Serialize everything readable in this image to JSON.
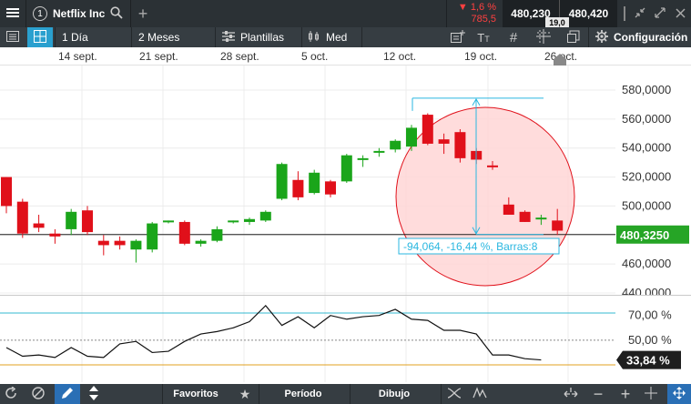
{
  "header": {
    "menu_icon": "hamburger-menu-icon",
    "tab_number": "1",
    "instrument_name": "Netflix Inc",
    "change_percent": "1,6 %",
    "change_points": "785,5",
    "bid_price": "480,230",
    "spread": "19,0",
    "ask_price": "480,420"
  },
  "toolbar": {
    "interval": "1 Día",
    "range": "2 Meses",
    "templates": "Plantillas",
    "chart_type": "Med",
    "settings": "Configuración"
  },
  "date_axis": [
    "14 sept.",
    "21 sept.",
    "28 sept.",
    "5 oct.",
    "12 oct.",
    "19 oct.",
    "26 oct."
  ],
  "chart_data": {
    "type": "candlestick",
    "instrument": "Netflix Inc",
    "y_ticks": [
      "580,0000",
      "560,0000",
      "540,0000",
      "520,0000",
      "500,0000",
      "480,0000",
      "460,0000",
      "440,0000"
    ],
    "ylim": [
      440,
      590
    ],
    "current_price_label": "480,3250",
    "current_price": 480.325,
    "up_color": "#1aa51a",
    "down_color": "#e0101a",
    "candles": [
      {
        "o": 520,
        "h": 520,
        "l": 495,
        "c": 500
      },
      {
        "o": 503,
        "h": 505,
        "l": 478,
        "c": 481
      },
      {
        "o": 488,
        "h": 494,
        "l": 482,
        "c": 485
      },
      {
        "o": 481,
        "h": 484,
        "l": 474,
        "c": 479
      },
      {
        "o": 484,
        "h": 498,
        "l": 480,
        "c": 496
      },
      {
        "o": 497,
        "h": 500,
        "l": 480,
        "c": 482
      },
      {
        "o": 476,
        "h": 480,
        "l": 466,
        "c": 473
      },
      {
        "o": 476,
        "h": 479,
        "l": 470,
        "c": 473
      },
      {
        "o": 470,
        "h": 477,
        "l": 461,
        "c": 476
      },
      {
        "o": 470,
        "h": 489,
        "l": 468,
        "c": 488
      },
      {
        "o": 489,
        "h": 490,
        "l": 488,
        "c": 490
      },
      {
        "o": 489,
        "h": 490,
        "l": 473,
        "c": 474
      },
      {
        "o": 474,
        "h": 477,
        "l": 472,
        "c": 476
      },
      {
        "o": 476,
        "h": 486,
        "l": 475,
        "c": 484
      },
      {
        "o": 489,
        "h": 490,
        "l": 488,
        "c": 490
      },
      {
        "o": 489,
        "h": 492,
        "l": 487,
        "c": 491
      },
      {
        "o": 490,
        "h": 497,
        "l": 489,
        "c": 496
      },
      {
        "o": 505,
        "h": 530,
        "l": 504,
        "c": 529
      },
      {
        "o": 518,
        "h": 524,
        "l": 504,
        "c": 506
      },
      {
        "o": 509,
        "h": 525,
        "l": 508,
        "c": 523
      },
      {
        "o": 517,
        "h": 518,
        "l": 506,
        "c": 508
      },
      {
        "o": 517,
        "h": 536,
        "l": 516,
        "c": 535
      },
      {
        "o": 533,
        "h": 535,
        "l": 527,
        "c": 533
      },
      {
        "o": 537,
        "h": 540,
        "l": 534,
        "c": 538
      },
      {
        "o": 539,
        "h": 546,
        "l": 537,
        "c": 545
      },
      {
        "o": 541,
        "h": 556,
        "l": 538,
        "c": 554
      },
      {
        "o": 563,
        "h": 564,
        "l": 542,
        "c": 543
      },
      {
        "o": 546,
        "h": 550,
        "l": 536,
        "c": 543
      },
      {
        "o": 551,
        "h": 553,
        "l": 530,
        "c": 533
      },
      {
        "o": 538,
        "h": 540,
        "l": 529,
        "c": 532
      },
      {
        "o": 528,
        "h": 531,
        "l": 525,
        "c": 527
      },
      {
        "o": 501,
        "h": 506,
        "l": 494,
        "c": 494
      },
      {
        "o": 496,
        "h": 497,
        "l": 489,
        "c": 489
      },
      {
        "o": 491,
        "h": 494,
        "l": 487,
        "c": 492
      },
      {
        "o": 490,
        "h": 498,
        "l": 480,
        "c": 483
      }
    ],
    "measurement_label": "-94,064, -16,44 %, Barras:8",
    "measure_from": 574.4,
    "measure_to": 480.3,
    "oscillator": {
      "y_ticks": [
        "70,00 %",
        "50,00 %"
      ],
      "ylim": [
        20,
        80
      ],
      "upper_level": 72,
      "middle_level": 50,
      "lower_level": 30,
      "current_label": "33,84 %",
      "values": [
        44,
        37,
        38,
        36,
        44,
        37,
        36,
        47,
        49,
        40,
        41,
        49,
        55,
        57,
        60,
        65,
        78,
        62,
        69,
        60,
        70,
        67,
        69,
        70,
        75,
        67,
        66,
        58,
        58,
        55,
        38,
        38,
        35,
        34
      ]
    }
  },
  "bottom": {
    "favorites": "Favoritos",
    "period": "Período",
    "drawing": "Dibujo"
  },
  "colors": {
    "header_bg": "#2b3135",
    "toolbar_bg": "#363d42",
    "price_label_bg": "#26a526",
    "osc_label_bg": "#1e1e1e",
    "negative": "#ff4040",
    "accent_cyan": "#2ab7e0",
    "circle_fill": "#ffd6d6"
  }
}
